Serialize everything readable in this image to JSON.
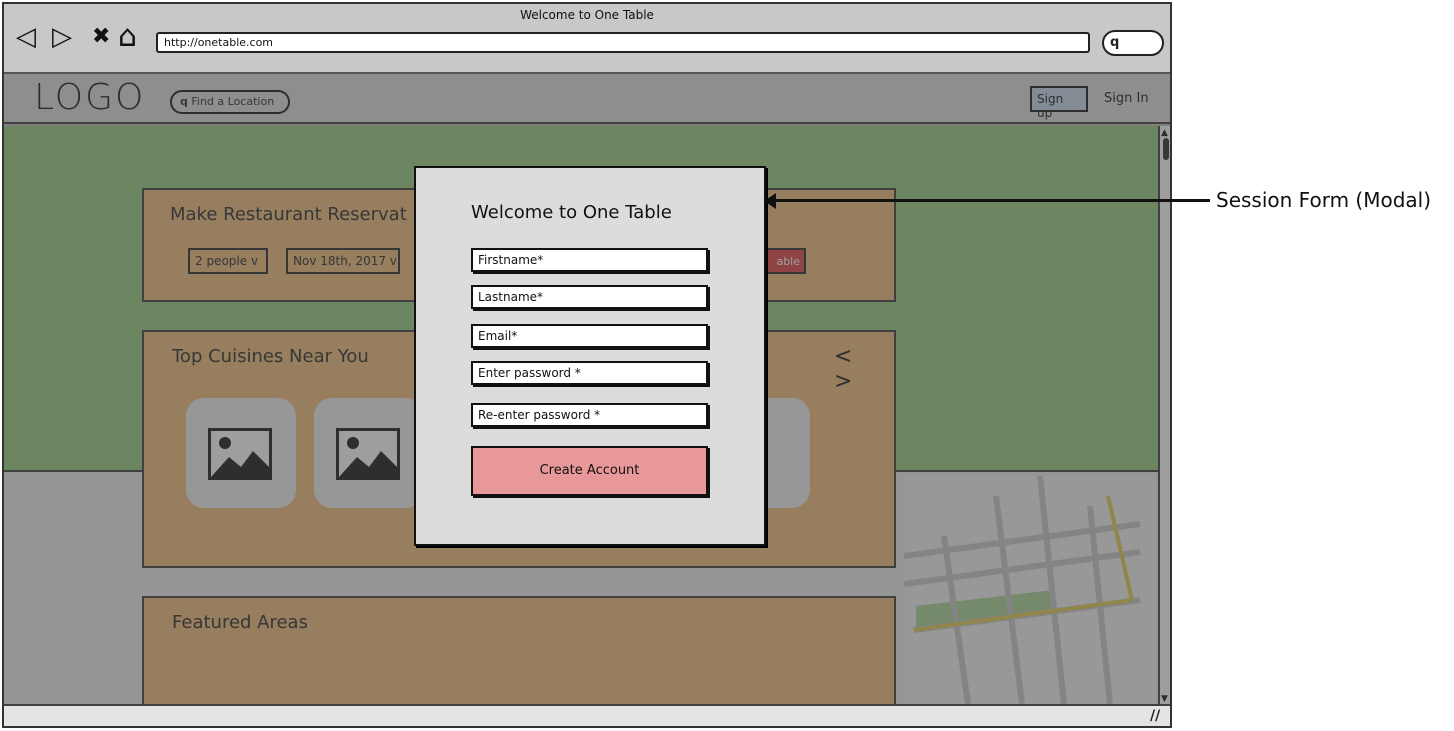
{
  "browser": {
    "window_title": "Welcome to One Table",
    "url": "http://onetable.com",
    "nav_icons": {
      "back": "◁",
      "forward": "▷",
      "close": "✖",
      "home": "⌂",
      "search": "q"
    },
    "scroll_up": "▲",
    "scroll_down": "▼",
    "resize_grip": "//"
  },
  "header": {
    "logo": "LOGO",
    "search_placeholder": "Find a Location",
    "search_icon": "q",
    "signup_label": "Sign up",
    "signin_label": "Sign In"
  },
  "reservation": {
    "title": "Make Restaurant Reservat",
    "party_size": "2 people  v",
    "date": "Nov 18th, 2017  v",
    "find_label": "able"
  },
  "cuisines": {
    "title": "Top Cuisines Near You",
    "nav": "< >"
  },
  "featured": {
    "title": "Featured Areas"
  },
  "modal": {
    "title": "Welcome to One Table",
    "fields": {
      "firstname": "Firstname*",
      "lastname": "Lastname*",
      "email": "Email*",
      "password": "Enter password *",
      "password_confirm": "Re-enter password *"
    },
    "submit_label": "Create Account"
  },
  "annotation": {
    "label": "Session Form (Modal)"
  },
  "colors": {
    "hero": "#a2d48e",
    "card": "#f2c58a",
    "button_primary": "#e89898",
    "signup_button": "#cfe0ee"
  }
}
